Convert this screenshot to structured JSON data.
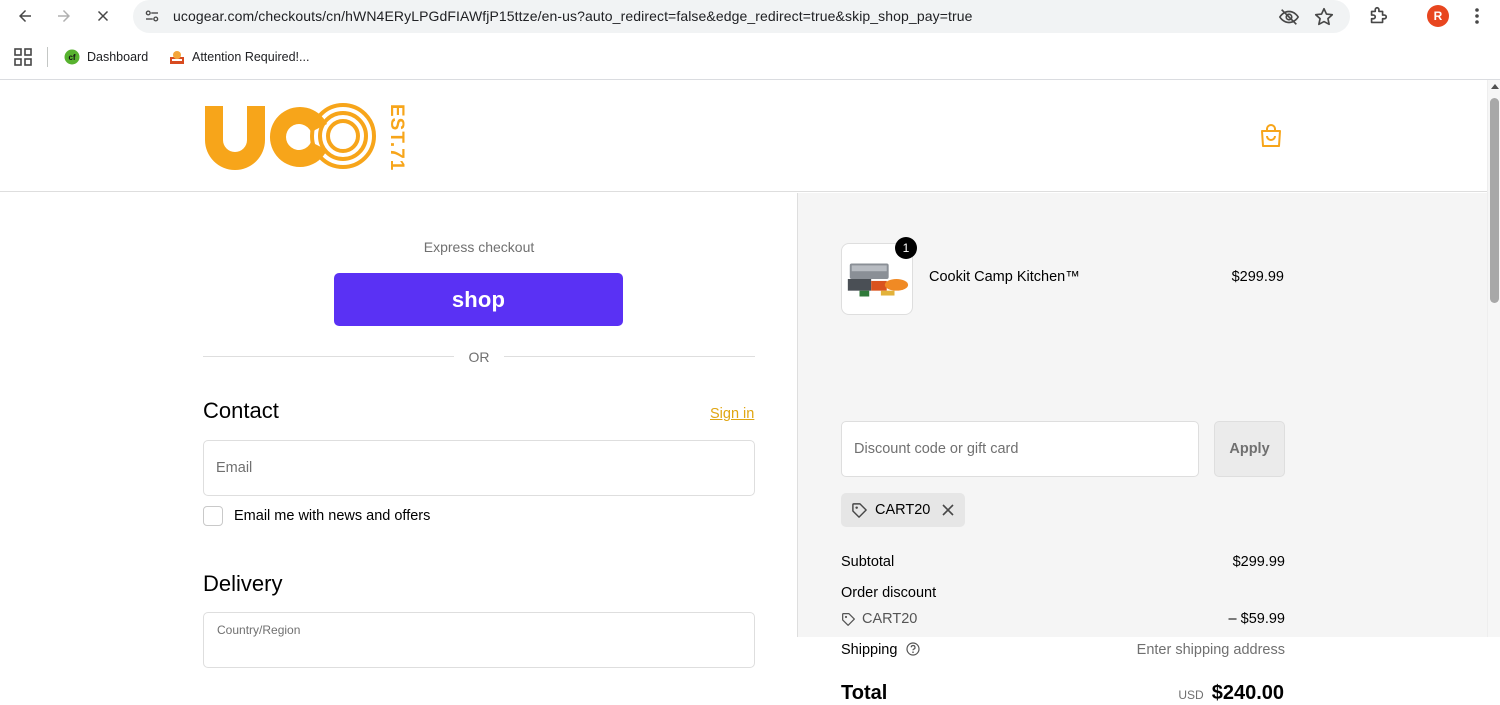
{
  "browser": {
    "url": "ucogear.com/checkouts/cn/hWN4ERyLPGdFIAWfjP15ttze/en-us?auto_redirect=false&edge_redirect=true&skip_shop_pay=true",
    "avatar_letter": "R",
    "bookmarks": [
      {
        "label": "Dashboard",
        "icon": "dashboard-favicon"
      },
      {
        "label": "Attention Required!...",
        "icon": "cloudflare-favicon"
      }
    ]
  },
  "brand": {
    "accent_color": "#f7a51a",
    "shop_pay_color": "#5a31f4"
  },
  "checkout": {
    "express_label": "Express checkout",
    "shop_button_label": "shop",
    "or_label": "OR",
    "contact_title": "Contact",
    "signin_label": "Sign in",
    "email_placeholder": "Email",
    "newsletter_label": "Email me with news and offers",
    "delivery_title": "Delivery",
    "country_label": "Country/Region"
  },
  "summary": {
    "item": {
      "quantity": "1",
      "name": "Cookit Camp Kitchen™",
      "price": "$299.99"
    },
    "discount_placeholder": "Discount code or gift card",
    "apply_label": "Apply",
    "applied_code": "CART20",
    "subtotal_label": "Subtotal",
    "subtotal_value": "$299.99",
    "order_discount_label": "Order discount",
    "discount_code": "CART20",
    "discount_value": "– $59.99",
    "shipping_label": "Shipping",
    "shipping_value": "Enter shipping address",
    "total_label": "Total",
    "total_currency": "USD",
    "total_value": "$240.00"
  }
}
